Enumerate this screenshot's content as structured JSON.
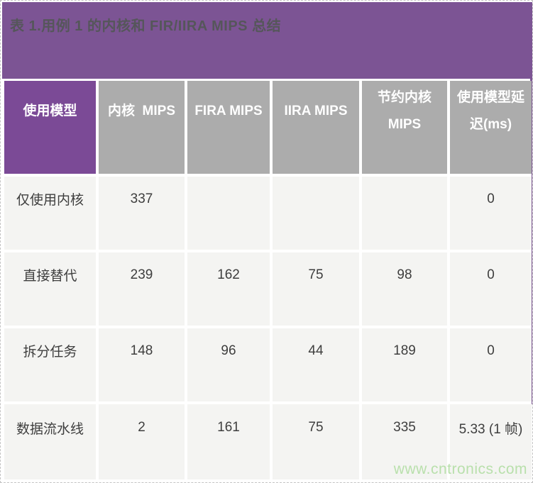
{
  "page": {
    "title": "表 1.用例 1 的内核和 FIR/IIRA MIPS 总结",
    "watermark": "www.cntronics.com"
  },
  "colors": {
    "banner_purple": "#7c5494",
    "header_cell_purple": "#7b4a96",
    "header_gray": "#acacac",
    "row_background": "#f4f4f2",
    "title_text": "#55565a",
    "body_text": "#3e3e3e",
    "watermark_green": "#b9e0ac"
  },
  "chart_data": {
    "type": "table",
    "title": "表 1.用例 1 的内核和 FIR/IIRA MIPS 总结",
    "columns": [
      "使用模型",
      "内核  MIPS",
      "FIRA MIPS",
      "IIRA MIPS",
      "节约内核 MIPS",
      "使用模型延迟(ms)"
    ],
    "rows": [
      [
        "仅使用内核",
        "337",
        "",
        "",
        "",
        "0"
      ],
      [
        "直接替代",
        "239",
        "162",
        "75",
        "98",
        "0"
      ],
      [
        "拆分任务",
        "148",
        "96",
        "44",
        "189",
        "0"
      ],
      [
        "数据流水线",
        "2",
        "161",
        "75",
        "335",
        "5.33 (1 帧)"
      ]
    ],
    "layout_hints": {
      "first_header_cell_color": "purple",
      "other_header_cells_color": "gray",
      "grid": "white gaps between cells",
      "header_rows": 1,
      "data_rows": 4
    }
  }
}
